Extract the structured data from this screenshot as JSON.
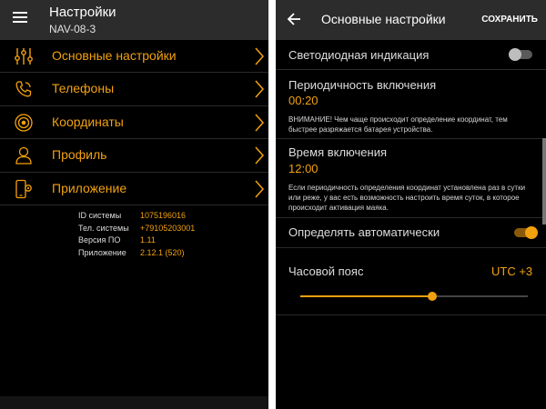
{
  "left": {
    "title": "Настройки",
    "subtitle": "NAV-08-3",
    "menu": [
      {
        "label": "Основные настройки",
        "icon": "sliders-icon"
      },
      {
        "label": "Телефоны",
        "icon": "phone-icon"
      },
      {
        "label": "Координаты",
        "icon": "location-target-icon"
      },
      {
        "label": "Профиль",
        "icon": "person-icon"
      },
      {
        "label": "Приложение",
        "icon": "phone-settings-icon"
      }
    ],
    "info": [
      {
        "key": "ID системы",
        "value": "1075196016"
      },
      {
        "key": "Тел. системы",
        "value": "+79105203001"
      },
      {
        "key": "Версия ПО",
        "value": "1.11"
      },
      {
        "key": "Приложение",
        "value": "2.12.1 (520)"
      }
    ]
  },
  "right": {
    "title": "Основные настройки",
    "save_label": "СОХРАНИТЬ",
    "led_label": "Светодиодная индикация",
    "led_on": false,
    "period_label": "Периодичность включения",
    "period_value": "00:20",
    "period_note": "ВНИМАНИЕ! Чем чаще происходит определение координат, тем быстрее разряжается батарея устройства.",
    "time_label": "Время включения",
    "time_value": "12:00",
    "time_note": "Если периодичность определения координат установлена раз в сутки или реже, у вас есть возможность настроить время суток, в которое происходит активация маяка.",
    "auto_label": "Определять автоматически",
    "auto_on": true,
    "tz_label": "Часовой пояс",
    "tz_value": "UTC +3",
    "tz_slider_fraction": 0.58
  },
  "colors": {
    "accent": "#f2a10f",
    "header": "#2c2c2c",
    "background": "#000000"
  }
}
